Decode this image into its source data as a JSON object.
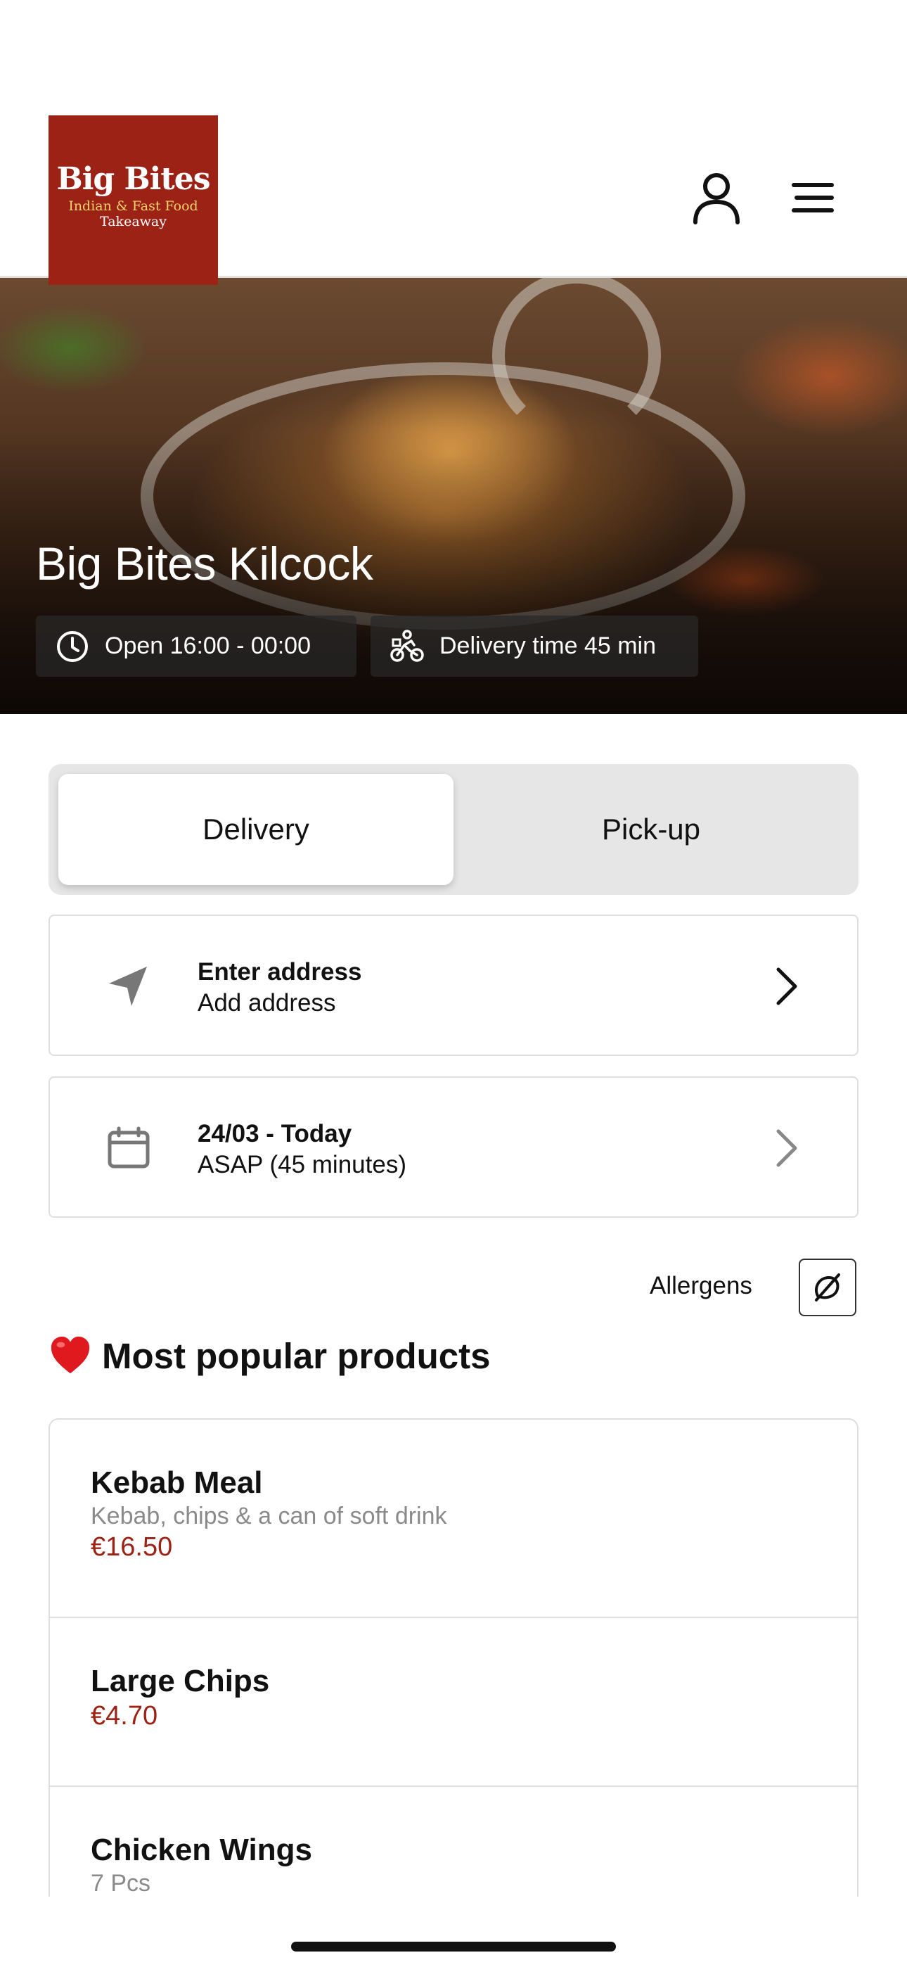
{
  "header": {
    "logo": {
      "title": "Big Bites",
      "subtitle": "Indian & Fast Food",
      "subtitle2": "Takeaway",
      "bg_color": "#9c2216"
    },
    "user_icon": "user-icon",
    "menu_icon": "hamburger-menu-icon"
  },
  "hero": {
    "title": "Big Bites Kilcock",
    "open_hours": "Open 16:00 - 00:00",
    "delivery_time": "Delivery time 45 min"
  },
  "order_mode": {
    "options": [
      "Delivery",
      "Pick-up"
    ],
    "selected": "Delivery"
  },
  "address": {
    "title": "Enter address",
    "subtitle": "Add address",
    "icon": "navigation-arrow-icon"
  },
  "schedule": {
    "title": "24/03 - Today",
    "subtitle": "ASAP (45 minutes)",
    "icon": "calendar-icon"
  },
  "allergens": {
    "label": "Allergens",
    "icon": "no-allergen-icon"
  },
  "popular": {
    "title": "Most popular products",
    "icon": "heart-icon",
    "products": [
      {
        "name": "Kebab Meal",
        "description": "Kebab, chips & a can of soft drink",
        "price": "€16.50"
      },
      {
        "name": "Large Chips",
        "price": "€4.70"
      },
      {
        "name": "Chicken Wings",
        "description": "7 Pcs"
      }
    ]
  },
  "colors": {
    "accent": "#9c2216",
    "price": "#9c2216",
    "muted_text": "#8a8a8a",
    "toggle_bg": "#e6e6e6"
  }
}
